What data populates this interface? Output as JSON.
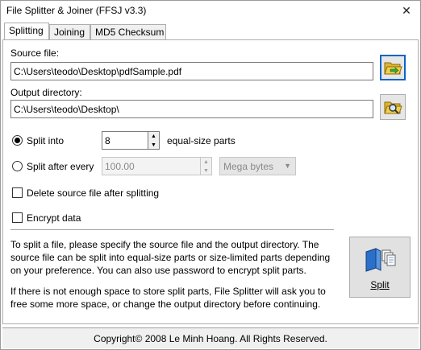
{
  "window": {
    "title": "File Splitter & Joiner (FFSJ v3.3)",
    "close_glyph": "✕"
  },
  "tabs": [
    {
      "label": "Splitting",
      "active": true
    },
    {
      "label": "Joining",
      "active": false
    },
    {
      "label": "MD5 Checksum",
      "active": false
    }
  ],
  "source": {
    "label": "Source file:",
    "value": "C:\\Users\\teodo\\Desktop\\pdfSample.pdf",
    "browse_icon": "folder-browse-icon"
  },
  "output": {
    "label": "Output directory:",
    "value": "C:\\Users\\teodo\\Desktop\\",
    "browse_icon": "folder-search-icon"
  },
  "split_mode": {
    "split_into_label": "Split into",
    "split_into_selected": true,
    "parts_value": "8",
    "parts_suffix": "equal-size parts",
    "split_every_label": "Split after every",
    "split_every_selected": false,
    "size_value": "100.00",
    "unit_value": "Mega bytes"
  },
  "options": {
    "delete_source_label": "Delete source file after splitting",
    "delete_source_checked": false,
    "encrypt_label": "Encrypt data",
    "encrypt_checked": false
  },
  "info": {
    "paragraph1": "To split a file, please specify the source file and the output directory. The source file can be split into equal-size parts or size-limited parts depending on your preference. You can also use password to encrypt split parts.",
    "paragraph2": "If there is not enough space to store split parts, File Splitter will ask you to free some more space, or change the output directory before continuing."
  },
  "split_button": {
    "label": "Split",
    "icon": "split-files-icon"
  },
  "status": {
    "copyright": "Copyright© 2008 Le Minh Hoang. All Rights Reserved."
  },
  "colors": {
    "focus_border": "#0a64c8",
    "folder_yellow": "#f2cf4a",
    "book_blue": "#2a6fc9"
  }
}
